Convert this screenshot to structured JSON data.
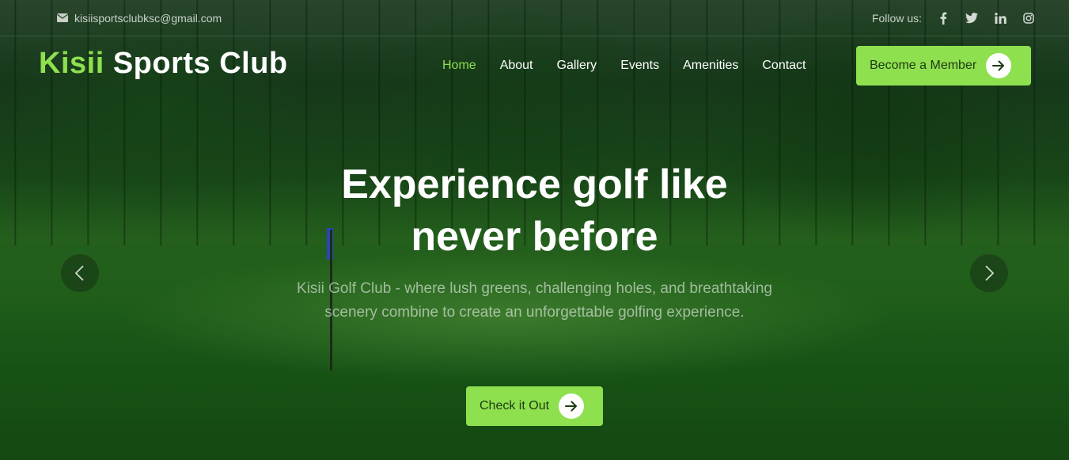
{
  "topbar": {
    "email": "kisiisportsclubksc@gmail.com",
    "follow_label": "Follow us:",
    "social_icons": [
      "facebook-icon",
      "twitter-icon",
      "linkedin-icon",
      "instagram-icon"
    ]
  },
  "brand": {
    "accent": "Kisii",
    "rest": "Sports Club",
    "accent_color": "#8ee04f"
  },
  "nav": {
    "items": [
      "Home",
      "About",
      "Gallery",
      "Events",
      "Amenities",
      "Contact"
    ],
    "active": "Home",
    "cta_label": "Become a Member"
  },
  "hero": {
    "headline_line1": "Experience golf like",
    "headline_line2": "never before",
    "subtext": "Kisii Golf Club - where lush greens, challenging holes, and breathtaking scenery combine to create an unforgettable golfing experience.",
    "cta_label": "Check it Out"
  }
}
